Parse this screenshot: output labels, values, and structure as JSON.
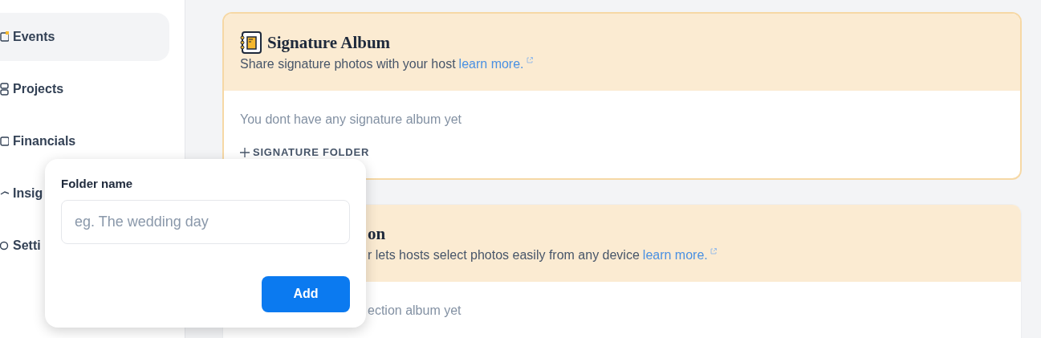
{
  "sidebar": {
    "items": [
      {
        "label": "Events",
        "selected": true
      },
      {
        "label": "Projects",
        "selected": false
      },
      {
        "label": "Financials",
        "selected": false
      },
      {
        "label": "Insig",
        "selected": false
      },
      {
        "label": "Setti",
        "selected": false
      }
    ]
  },
  "cards": [
    {
      "title": "Signature Album",
      "description": "Share signature photos with your host",
      "link": "learn more.",
      "empty_text": "You dont have any signature album yet",
      "action": "SIGNATURE FOLDER",
      "highlighted": true,
      "covered": false
    },
    {
      "title": "on",
      "description": "r lets hosts select photos easily from any device",
      "link": "learn more.",
      "empty_text": "ection album yet",
      "highlighted": false,
      "covered": true
    }
  ],
  "popover": {
    "label": "Folder name",
    "placeholder": "eg. The wedding day",
    "button": "Add"
  }
}
